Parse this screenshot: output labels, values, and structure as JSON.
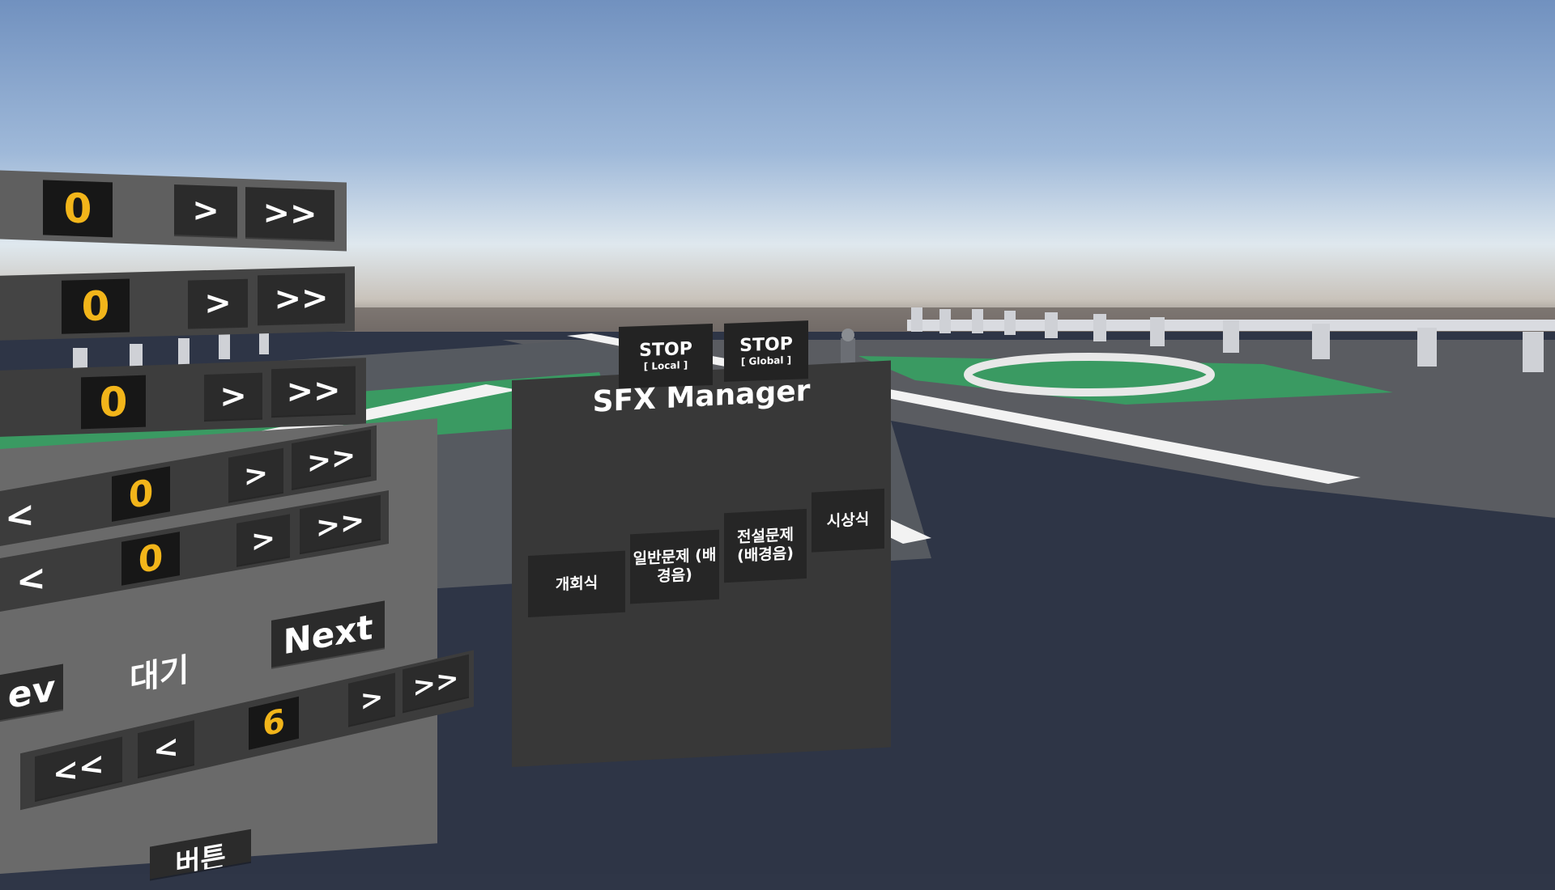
{
  "scoreboard_rows": [
    {
      "score": "0",
      "next": ">",
      "fast_forward": ">>"
    },
    {
      "score": "0",
      "next": ">",
      "fast_forward": ">>"
    },
    {
      "score": "0",
      "next": ">",
      "fast_forward": ">>"
    }
  ],
  "control_panel": {
    "rows": [
      {
        "prev": "<",
        "score": "0",
        "next": ">",
        "fast_forward": ">>"
      },
      {
        "prev": "<",
        "score": "0",
        "next": ">",
        "fast_forward": ">>"
      }
    ],
    "prev_partial": "ev",
    "status_label": "대기",
    "next_label": "Next",
    "round": {
      "rewind": "<<",
      "prev": "<",
      "value": "6",
      "next": ">",
      "fast_forward": ">>"
    },
    "bottom_partial": "버튼"
  },
  "sfx_manager": {
    "title": "SFX Manager",
    "stop_local": {
      "label": "STOP",
      "sub": "[ Local ]"
    },
    "stop_global": {
      "label": "STOP",
      "sub": "[ Global ]"
    },
    "buttons": [
      {
        "label": "개회식"
      },
      {
        "label": "일반문제 (배경음)"
      },
      {
        "label": "전설문제 (배경음)"
      },
      {
        "label": "시상식"
      }
    ]
  }
}
